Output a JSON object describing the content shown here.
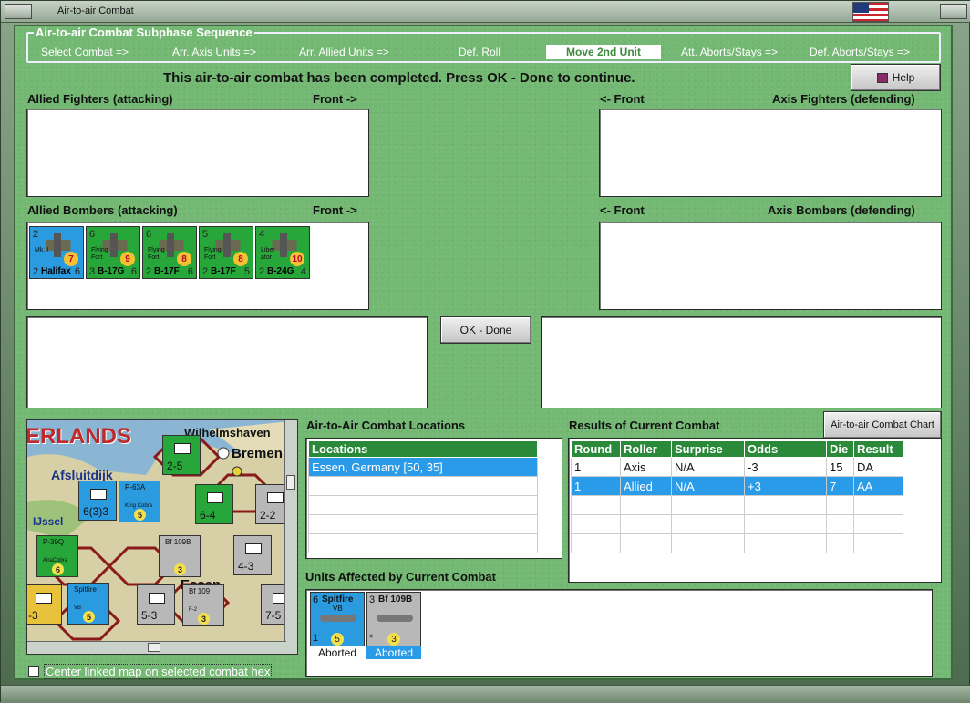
{
  "window": {
    "title": "Air-to-air Combat"
  },
  "sequence": {
    "title": "Air-to-air Combat Subphase Sequence",
    "steps": [
      "Select Combat =>",
      "Arr. Axis Units =>",
      "Arr. Allied Units =>",
      "Def. Roll",
      "Move 2nd Unit",
      "Att. Aborts/Stays =>",
      "Def. Aborts/Stays =>"
    ],
    "active_index": 4
  },
  "banner": "This air-to-air combat has been completed.  Press OK - Done to continue.",
  "help_label": "Help",
  "ok_label": "OK - Done",
  "chart_button_label": "Air-to-air Combat Chart",
  "sections": {
    "allied_fighters": "Allied Fighters (attacking)",
    "axis_fighters": "Axis Fighters (defending)",
    "allied_bombers": "Allied Bombers (attacking)",
    "axis_bombers": "Axis Bombers (defending)",
    "front_right": "Front ->",
    "front_left": "<- Front"
  },
  "bombers": [
    {
      "name": "Halifax",
      "class": "Mk. I",
      "top": "2",
      "left_bottom": "2",
      "right_bottom": "6",
      "value": "7",
      "color": "#2b9be0"
    },
    {
      "name": "B-17G",
      "class": "Flying Fort",
      "top": "6",
      "left_bottom": "3",
      "right_bottom": "6",
      "value": "9",
      "color": "#27a63a"
    },
    {
      "name": "B-17F",
      "class": "Flying Fort",
      "top": "6",
      "left_bottom": "2",
      "right_bottom": "6",
      "value": "8",
      "color": "#27a63a"
    },
    {
      "name": "B-17F",
      "class": "Flying Fort",
      "top": "5",
      "left_bottom": "2",
      "right_bottom": "5",
      "value": "8",
      "color": "#27a63a"
    },
    {
      "name": "B-24G",
      "class": "Liber ator",
      "top": "4",
      "left_bottom": "2",
      "right_bottom": "4",
      "value": "10",
      "color": "#27a63a"
    }
  ],
  "locations": {
    "title": "Air-to-Air Combat Locations",
    "header": "Locations",
    "rows": [
      "Essen, Germany [50, 35]"
    ]
  },
  "results": {
    "title": "Results of Current Combat",
    "headers": [
      "Round",
      "Roller",
      "Surprise",
      "Odds",
      "Die",
      "Result"
    ],
    "rows": [
      [
        "1",
        "Axis",
        "N/A",
        "-3",
        "15",
        "DA"
      ],
      [
        "1",
        "Allied",
        "N/A",
        "+3",
        "7",
        "AA"
      ]
    ]
  },
  "affected": {
    "title": "Units Affected by Current Combat",
    "units": [
      {
        "name": "Spitfire",
        "sub": "VB",
        "top": "6",
        "value": "5",
        "bottom": "1",
        "status": "Aborted",
        "color": "#2b9be0"
      },
      {
        "name": "Bf 109B",
        "sub": "",
        "top": "3",
        "value": "3",
        "bottom": "*",
        "status": "Aborted",
        "color": "#b8b8b8"
      }
    ]
  },
  "map": {
    "labels": [
      "ERLANDS",
      "Wilhelmshaven",
      "Bremen",
      "Afsluitdijk",
      "IJssel",
      "Essen"
    ],
    "checkbox_label": "Center linked map on selected combat hex"
  },
  "map_units": [
    {
      "name": "P-63A",
      "sub": "King Cobra",
      "v": "5"
    },
    {
      "name": "P-39Q",
      "sub": "AiraCobra",
      "v": "6"
    },
    {
      "name": "Spitfire",
      "sub": "VB",
      "v": "5"
    },
    {
      "name": "Bf 109B",
      "sub": "",
      "v": "3"
    },
    {
      "name": "Bf 109",
      "sub": "F-2",
      "v": "3"
    }
  ],
  "map_ground": [
    "2-5",
    "6(3)3",
    "6-4",
    "2-2",
    "4-3",
    "5-3",
    "7-5",
    "-3"
  ],
  "colors": {
    "accent_green": "#2b8a3a",
    "select_blue": "#2a9be8",
    "panel_green": "#73b873"
  }
}
